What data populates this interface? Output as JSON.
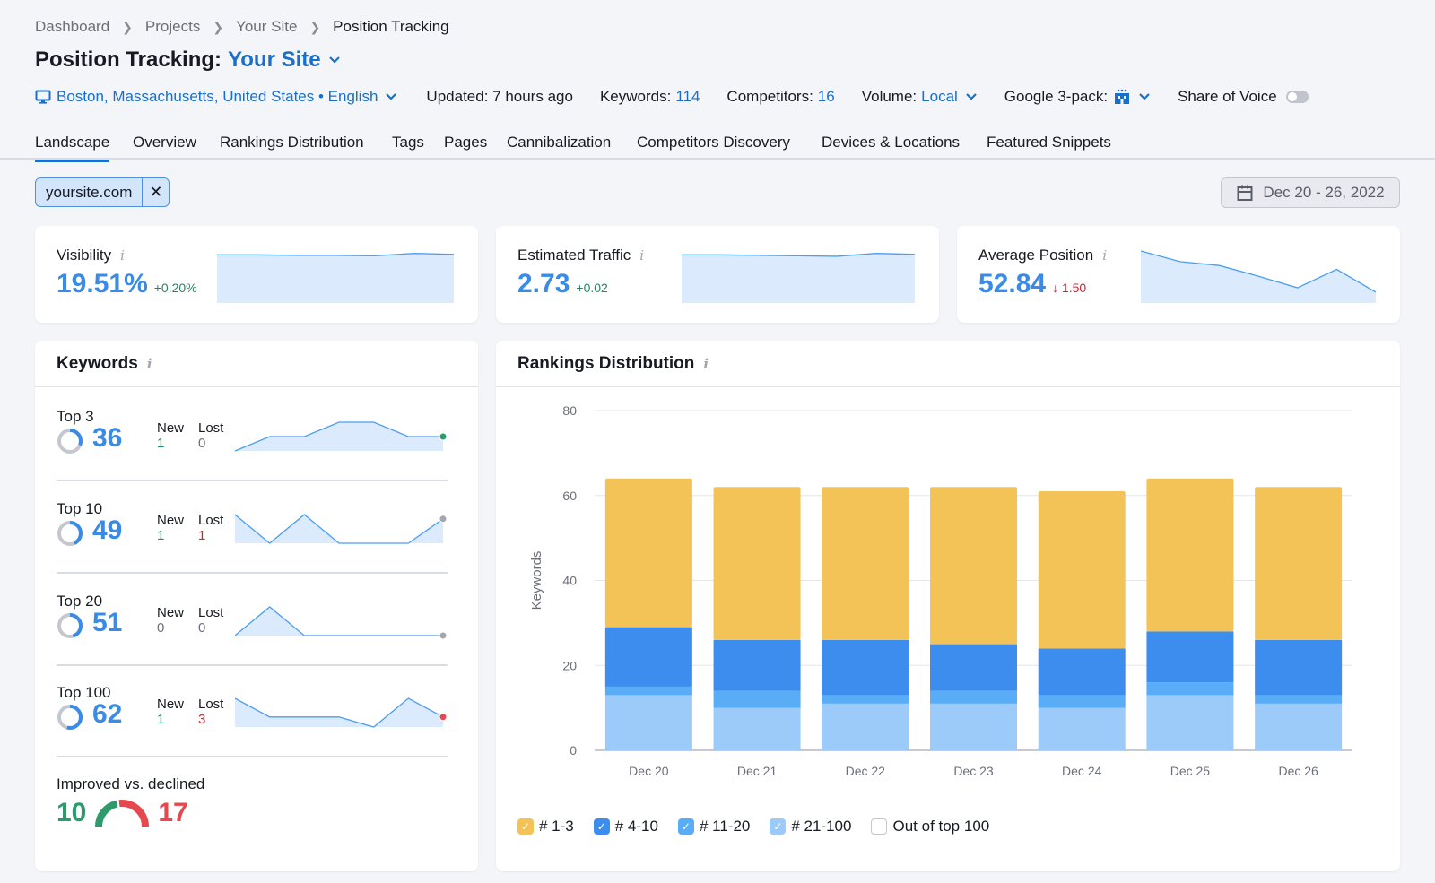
{
  "breadcrumb": [
    "Dashboard",
    "Projects",
    "Your Site",
    "Position Tracking"
  ],
  "title": {
    "prefix": "Position Tracking:",
    "site": "Your Site"
  },
  "meta": {
    "location": "Boston, Massachusetts, United States • English",
    "updated": "Updated: 7 hours ago",
    "keywords_label": "Keywords:",
    "keywords_value": "114",
    "competitors_label": "Competitors:",
    "competitors_value": "16",
    "volume_label": "Volume:",
    "volume_value": "Local",
    "google_label": "Google 3-pack:",
    "sov_label": "Share of Voice",
    "sov_enabled": false
  },
  "tabs": [
    "Landscape",
    "Overview",
    "Rankings Distribution",
    "Tags",
    "Pages",
    "Cannibalization",
    "Competitors Discovery",
    "Devices & Locations",
    "Featured Snippets"
  ],
  "active_tab": "Landscape",
  "filter": {
    "label": "yoursite.com",
    "remove": "✕"
  },
  "date_range": "Dec 20 - 26, 2022",
  "kpis": [
    {
      "title": "Visibility",
      "value": "19.51%",
      "delta": "+0.20%",
      "dir": "up",
      "trend": [
        0.92,
        0.92,
        0.91,
        0.91,
        0.9,
        0.95,
        0.93
      ]
    },
    {
      "title": "Estimated Traffic",
      "value": "2.73",
      "delta": "+0.02",
      "dir": "up",
      "trend": [
        0.92,
        0.92,
        0.91,
        0.9,
        0.89,
        0.95,
        0.93
      ]
    },
    {
      "title": "Average Position",
      "value": "52.84",
      "delta": "↓ 1.50",
      "dir": "down",
      "trend": [
        1.0,
        0.78,
        0.7,
        0.48,
        0.24,
        0.62,
        0.15
      ]
    }
  ],
  "keywords_panel": {
    "title": "Keywords",
    "new_label": "New",
    "lost_label": "Lost",
    "rows": [
      {
        "label": "Top 3",
        "value": "36",
        "share": 0.31,
        "new": "1",
        "new_color": "green",
        "lost": "0",
        "lost_color": "gray",
        "trend": [
          0,
          0.5,
          0.5,
          1,
          1,
          0.5,
          0.5
        ],
        "dot": "#2d9b6c"
      },
      {
        "label": "Top 10",
        "value": "49",
        "share": 0.43,
        "new": "1",
        "new_color": "green",
        "lost": "1",
        "lost_color": "red",
        "trend": [
          1,
          0,
          1,
          0,
          0,
          0,
          0.85
        ],
        "dot": "#a3a6b0"
      },
      {
        "label": "Top 20",
        "value": "51",
        "share": 0.45,
        "new": "0",
        "new_color": "gray",
        "lost": "0",
        "lost_color": "gray",
        "trend": [
          0,
          1,
          0,
          0,
          0,
          0,
          0
        ],
        "dot": "#a3a6b0"
      },
      {
        "label": "Top 100",
        "value": "62",
        "share": 0.54,
        "new": "1",
        "new_color": "green",
        "lost": "3",
        "lost_color": "red",
        "trend": [
          1,
          0.35,
          0.35,
          0.35,
          0,
          1,
          0.35
        ],
        "dot": "#e5484d"
      }
    ],
    "improved_label": "Improved vs. declined",
    "improved": "10",
    "declined": "17"
  },
  "rankings_panel": {
    "title": "Rankings Distribution"
  },
  "chart_data": {
    "type": "bar",
    "stacked": true,
    "title": "Rankings Distribution",
    "xlabel": "",
    "ylabel": "Keywords",
    "ylim": [
      0,
      80
    ],
    "yticks": [
      0,
      20,
      40,
      60,
      80
    ],
    "grid": true,
    "legend_position": "bottom-left",
    "categories": [
      "Dec 20",
      "Dec 21",
      "Dec 22",
      "Dec 23",
      "Dec 24",
      "Dec 25",
      "Dec 26"
    ],
    "series": [
      {
        "name": "# 21-100",
        "color": "#9ccaf9",
        "values": [
          13,
          10,
          11,
          11,
          10,
          13,
          11
        ]
      },
      {
        "name": "# 11-20",
        "color": "#59adf7",
        "values": [
          2,
          4,
          2,
          3,
          3,
          3,
          2
        ]
      },
      {
        "name": "# 4-10",
        "color": "#3d8def",
        "values": [
          14,
          12,
          13,
          11,
          11,
          12,
          13
        ]
      },
      {
        "name": "# 1-3",
        "color": "#f3c358",
        "values": [
          35,
          36,
          36,
          37,
          37,
          36,
          36
        ]
      }
    ],
    "legend": [
      {
        "name": "# 1-3",
        "color": "#f3c358",
        "checked": true
      },
      {
        "name": "# 4-10",
        "color": "#3d8def",
        "checked": true
      },
      {
        "name": "# 11-20",
        "color": "#59adf7",
        "checked": true
      },
      {
        "name": "# 21-100",
        "color": "#9ccaf9",
        "checked": true
      },
      {
        "name": "Out of top 100",
        "color": "#ffffff",
        "checked": false
      }
    ]
  }
}
